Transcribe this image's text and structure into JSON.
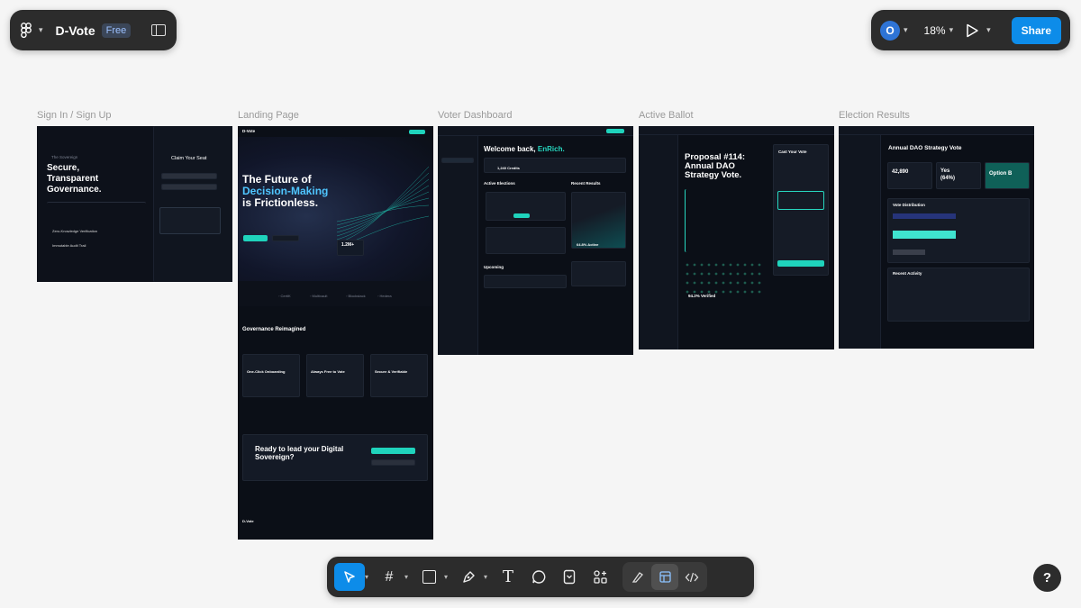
{
  "toolbar_left": {
    "title": "D-Vote",
    "plan_badge": "Free"
  },
  "toolbar_right": {
    "avatar_initial": "O",
    "zoom": "18%",
    "share_label": "Share"
  },
  "frames": [
    {
      "label": "Sign In / Sign Up"
    },
    {
      "label": "Landing Page"
    },
    {
      "label": "Voter Dashboard"
    },
    {
      "label": "Active Ballot"
    },
    {
      "label": "Election Results"
    }
  ],
  "signin": {
    "brand": "The Sovereign",
    "headline1": "Secure,",
    "headline2": "Transparent",
    "headline3": "Governance.",
    "claim": "Claim Your Seat"
  },
  "landing": {
    "logo": "D-Vote",
    "hero1": "The Future of",
    "hero2": "Decision-Making",
    "hero3": "is Frictionless.",
    "stat": "1.2M+",
    "features_title": "Governance Reimagined",
    "f1": "One-Click Onboarding",
    "f2": "Always Free to Vote",
    "f3": "Secure & Verifiable",
    "cta1": "Ready to lead your Digital",
    "cta2": "Sovereign?",
    "footer_logo": "D-Vote"
  },
  "dashboard": {
    "welcome": "Welcome back, ",
    "user": "EnRich.",
    "credits": "1,240 Credits",
    "active": "Active Elections",
    "recent": "Recent Results",
    "upcoming": "Upcoming",
    "pct": "64.8% Active"
  },
  "ballot": {
    "title1": "Proposal #114:",
    "title2": "Annual DAO",
    "title3": "Strategy Vote.",
    "cast": "Cast Your Vote",
    "verified": "94.2% Verified",
    "submit": "Submit Your Decision"
  },
  "results": {
    "title": "Annual DAO Strategy Vote",
    "total": "42,890",
    "yes": "Yes",
    "yes_pct": "(64%)",
    "option": "Option B",
    "distribution": "Vote Distribution",
    "activity": "Recent Activity"
  }
}
